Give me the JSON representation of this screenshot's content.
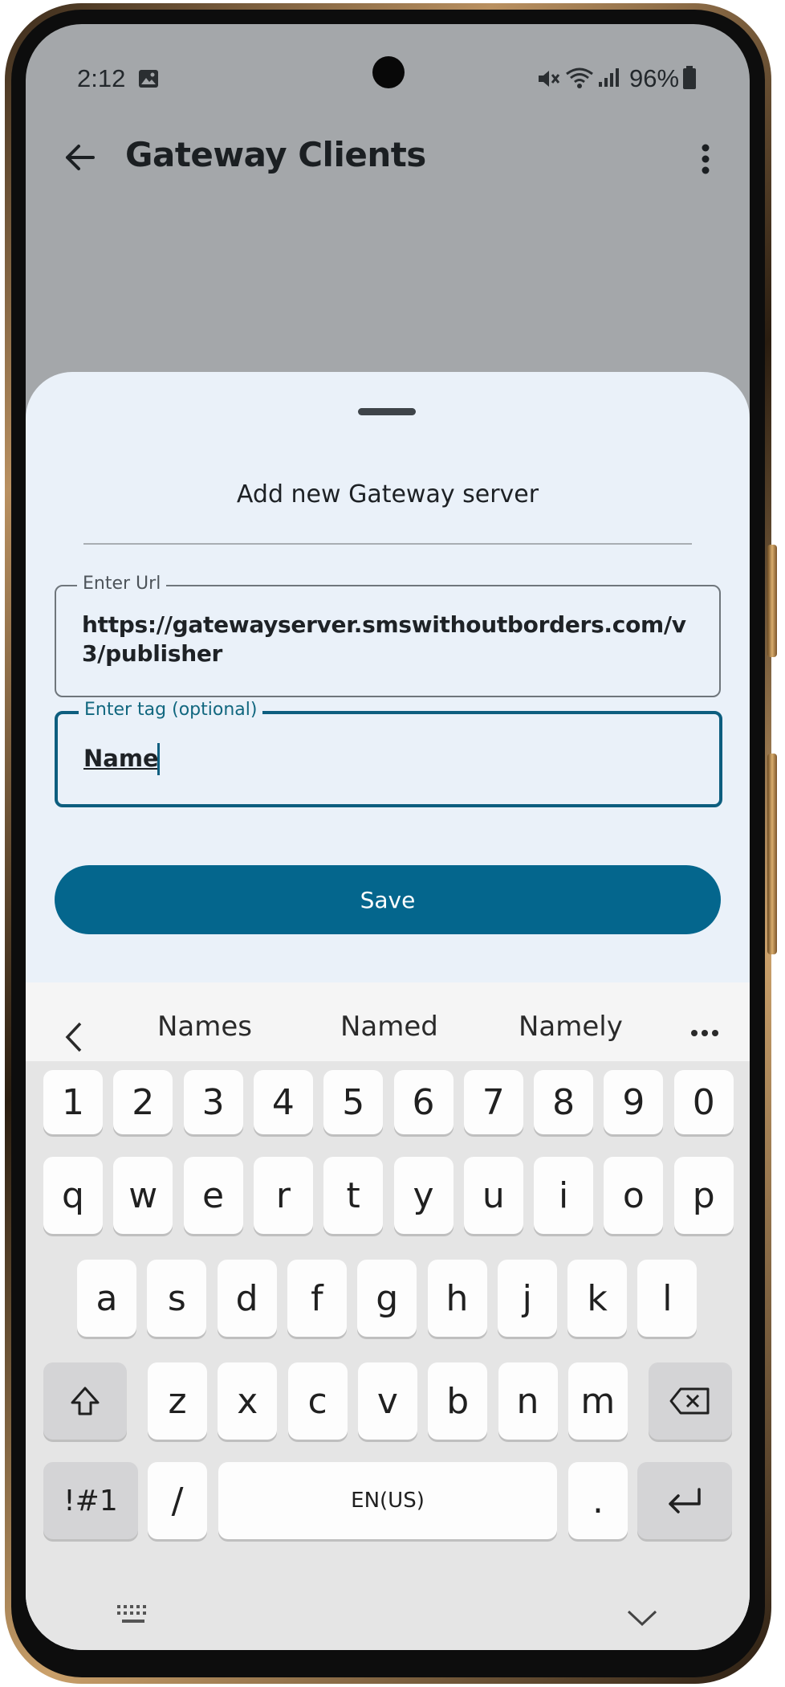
{
  "status_bar": {
    "time": "2:12",
    "battery": "96%",
    "icons": [
      "gallery-icon",
      "mute-icon",
      "wifi-icon",
      "signal-icon",
      "battery-icon"
    ]
  },
  "app_bar": {
    "title": "Gateway Clients",
    "back_icon": "arrow-left-icon",
    "menu_icon": "more-vert-icon"
  },
  "sheet": {
    "title": "Add new Gateway server",
    "url_field": {
      "label": "Enter Url",
      "value": "https://gatewayserver.smswithoutborders.com/v3/publisher"
    },
    "tag_field": {
      "label": "Enter tag (optional)",
      "value": "Name"
    },
    "save_label": "Save"
  },
  "keyboard": {
    "suggestions": [
      "Names",
      "Named",
      "Namely"
    ],
    "rows": {
      "numbers": [
        "1",
        "2",
        "3",
        "4",
        "5",
        "6",
        "7",
        "8",
        "9",
        "0"
      ],
      "row1": [
        "q",
        "w",
        "e",
        "r",
        "t",
        "y",
        "u",
        "i",
        "o",
        "p"
      ],
      "row2": [
        "a",
        "s",
        "d",
        "f",
        "g",
        "h",
        "j",
        "k",
        "l"
      ],
      "row3": [
        "z",
        "x",
        "c",
        "v",
        "b",
        "n",
        "m"
      ]
    },
    "symbols_label": "!#1",
    "slash_label": "/",
    "space_label": "EN(US)",
    "period_label": "."
  },
  "colors": {
    "accent": "#04668d",
    "sheet_bg": "#eaf1f9",
    "dim_bg": "#a4a7aa"
  }
}
